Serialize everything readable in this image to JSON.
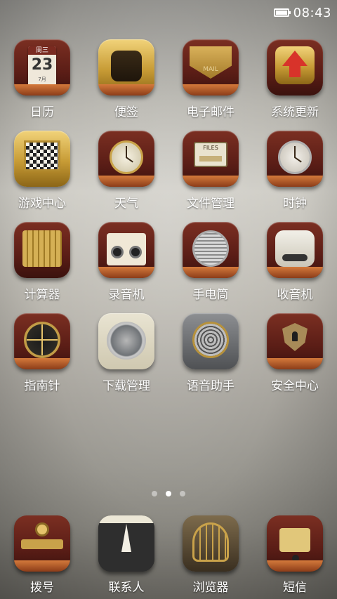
{
  "status_bar": {
    "time": "08:43"
  },
  "apps": [
    {
      "label": "日历",
      "icon": "calendar-icon",
      "calendar": {
        "weekday": "周三",
        "day": "23",
        "month": "7月"
      }
    },
    {
      "label": "便签",
      "icon": "notes-icon"
    },
    {
      "label": "电子邮件",
      "icon": "mail-icon",
      "engraving": "MAIL"
    },
    {
      "label": "系统更新",
      "icon": "system-update-icon"
    },
    {
      "label": "游戏中心",
      "icon": "game-center-icon"
    },
    {
      "label": "天气",
      "icon": "weather-icon"
    },
    {
      "label": "文件管理",
      "icon": "file-manager-icon",
      "engraving": "FILES"
    },
    {
      "label": "时钟",
      "icon": "clock-icon"
    },
    {
      "label": "计算器",
      "icon": "calculator-icon"
    },
    {
      "label": "录音机",
      "icon": "recorder-icon"
    },
    {
      "label": "手电筒",
      "icon": "flashlight-icon"
    },
    {
      "label": "收音机",
      "icon": "radio-icon"
    },
    {
      "label": "指南针",
      "icon": "compass-icon"
    },
    {
      "label": "下载管理",
      "icon": "download-manager-icon"
    },
    {
      "label": "语音助手",
      "icon": "voice-assistant-icon"
    },
    {
      "label": "安全中心",
      "icon": "security-center-icon"
    }
  ],
  "page_indicator": {
    "pages": 3,
    "current": 2
  },
  "dock": [
    {
      "label": "拨号",
      "icon": "phone-icon"
    },
    {
      "label": "联系人",
      "icon": "contacts-icon"
    },
    {
      "label": "浏览器",
      "icon": "browser-icon"
    },
    {
      "label": "短信",
      "icon": "messages-icon"
    }
  ]
}
